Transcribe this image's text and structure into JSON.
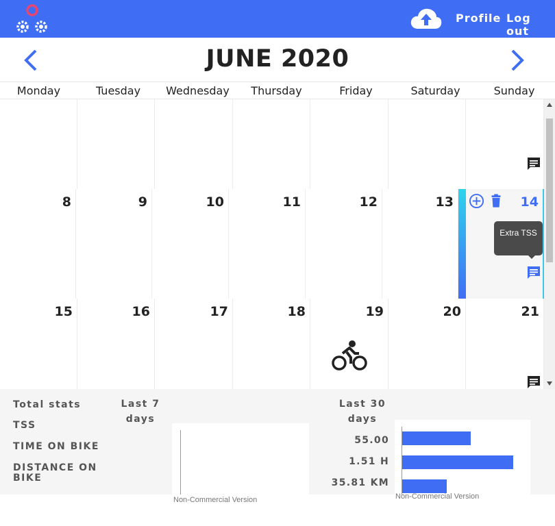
{
  "header": {
    "profile_label": "Profile",
    "logout_label": "Log out",
    "brand_color": "#3f6ef5",
    "logo_icon": "gears-logo-icon",
    "upload_icon": "cloud-upload-icon"
  },
  "calendar": {
    "month_title": "JUNE 2020",
    "weekdays": [
      "Monday",
      "Tuesday",
      "Wednesday",
      "Thursday",
      "Friday",
      "Saturday",
      "Sunday"
    ],
    "week2": [
      "8",
      "9",
      "10",
      "11",
      "12",
      "13",
      "14"
    ],
    "week3": [
      "15",
      "16",
      "17",
      "18",
      "19",
      "20",
      "21"
    ],
    "today_color": "#3f6ef5",
    "tooltip_text": "Extra TSS"
  },
  "stats": {
    "total_label": "Total stats",
    "tss_label": "TSS",
    "time_label": "TIME ON BIKE",
    "distance_label": "DISTANCE ON BIKE",
    "last7_label": "Last 7 days",
    "last30_label": "Last 30 days",
    "last30_values": [
      "55.00",
      "1.51 H",
      "35.81 KM"
    ],
    "watermark": "Non-Commercial Version",
    "chart_bar_color": "#3f6ef5"
  },
  "chart_data": [
    {
      "type": "bar",
      "orientation": "horizontal",
      "categories": [
        "TSS",
        "TIME ON BIKE",
        "DISTANCE ON BIKE"
      ],
      "values": [],
      "title": ""
    },
    {
      "type": "bar",
      "orientation": "horizontal",
      "categories": [
        "TSS",
        "TIME ON BIKE",
        "DISTANCE ON BIKE"
      ],
      "values": [
        0.62,
        1.0,
        0.4
      ],
      "value_scale": "relative bar length",
      "title": ""
    }
  ]
}
